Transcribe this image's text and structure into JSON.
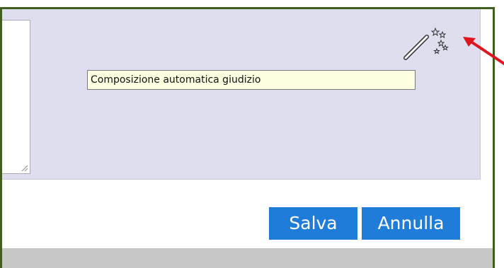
{
  "tooltip": {
    "text": "Composizione automatica giudizio"
  },
  "buttons": {
    "save_label": "Salva",
    "cancel_label": "Annulla"
  },
  "icons": {
    "wand": "magic-wand-icon",
    "arrow": "red-arrow-icon"
  },
  "colors": {
    "panel_bg": "#dfdeef",
    "frame_border": "#3e5e22",
    "button_bg": "#1f7dd9",
    "tooltip_bg": "#ffffe1",
    "arrow": "#e0141e"
  }
}
